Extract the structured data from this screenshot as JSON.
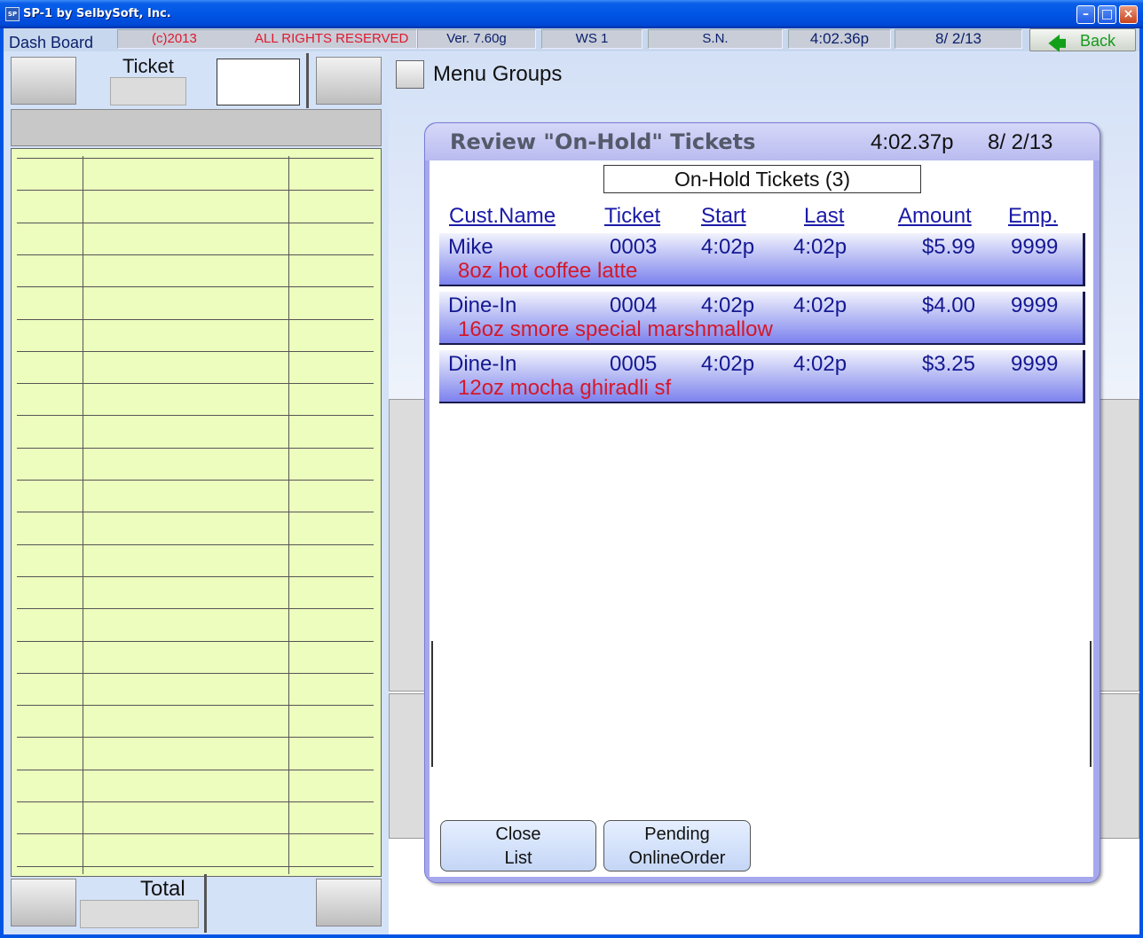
{
  "window": {
    "title": "SP-1 by SelbySoft, Inc.",
    "icon": "app-icon",
    "controls": [
      "minimize-icon",
      "maximize-icon",
      "close-icon"
    ]
  },
  "statusbar": {
    "dash_label": "Dash Board",
    "copyright": "(c)2013",
    "rights": "ALL RIGHTS RESERVED",
    "version": "Ver. 7.60g",
    "workstation": "WS  1",
    "serial": "S.N.",
    "time": "4:02.36p",
    "date": "8/ 2/13",
    "back_label": "Back"
  },
  "left_panel": {
    "ticket_label": "Ticket",
    "total_label": "Total"
  },
  "menu": {
    "label": "Menu Groups"
  },
  "dialog": {
    "title": "Review \"On-Hold\" Tickets",
    "time": "4:02.37p",
    "date": "8/  2/13",
    "count_label": "On-Hold Tickets  (3)",
    "columns": {
      "cust": "Cust.Name",
      "ticket": "Ticket",
      "start": "Start",
      "last": "Last",
      "amount": "Amount",
      "emp": "Emp."
    },
    "rows": [
      {
        "cust": "Mike",
        "ticket": "0003",
        "start": "4:02p",
        "last": "4:02p",
        "amount": "$5.99",
        "emp": "9999",
        "desc": "8oz hot coffee latte"
      },
      {
        "cust": "Dine-In",
        "ticket": "0004",
        "start": "4:02p",
        "last": "4:02p",
        "amount": "$4.00",
        "emp": "9999",
        "desc": "16oz smore special marshmallow"
      },
      {
        "cust": "Dine-In",
        "ticket": "0005",
        "start": "4:02p",
        "last": "4:02p",
        "amount": "$3.25",
        "emp": "9999",
        "desc": "12oz mocha ghiradli sf"
      }
    ],
    "close_line1": "Close",
    "close_line2": "List",
    "pending_line1": "Pending",
    "pending_line2": "OnlineOrder"
  },
  "colors": {
    "accent": "#0055e5",
    "grid_bg": "#ecfdbe",
    "row_text": "#141892",
    "desc_text": "#d4182a",
    "back_green": "#149a1c"
  }
}
